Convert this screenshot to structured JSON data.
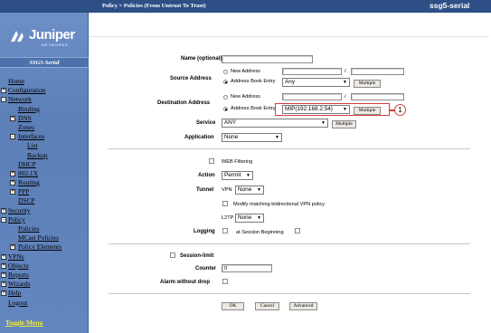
{
  "header": {
    "breadcrumb": "Policy > Policies (From Untrust To Trust)",
    "device_name": "ssg5-serial"
  },
  "sidebar": {
    "logo_text": "Juniper",
    "logo_subtext": "NETWORKS",
    "device_title": "SSG5-Serial",
    "items": [
      {
        "label": "Home",
        "level": 0,
        "expander": ""
      },
      {
        "label": "Configuration",
        "level": 0,
        "expander": "+"
      },
      {
        "label": "Network",
        "level": 0,
        "expander": "-"
      },
      {
        "label": "Binding",
        "level": 1,
        "expander": ""
      },
      {
        "label": "DNS",
        "level": 1,
        "expander": "+"
      },
      {
        "label": "Zones",
        "level": 1,
        "expander": ""
      },
      {
        "label": "Interfaces",
        "level": 1,
        "expander": "-"
      },
      {
        "label": "List",
        "level": 2,
        "expander": ""
      },
      {
        "label": "Backup",
        "level": 2,
        "expander": ""
      },
      {
        "label": "DHCP",
        "level": 1,
        "expander": ""
      },
      {
        "label": "802.1X",
        "level": 1,
        "expander": "+"
      },
      {
        "label": "Routing",
        "level": 1,
        "expander": "+"
      },
      {
        "label": "PPP",
        "level": 1,
        "expander": "+"
      },
      {
        "label": "DSCP",
        "level": 1,
        "expander": ""
      },
      {
        "label": "Security",
        "level": 0,
        "expander": "+"
      },
      {
        "label": "Policy",
        "level": 0,
        "expander": "-"
      },
      {
        "label": "Policies",
        "level": 1,
        "expander": ""
      },
      {
        "label": "MCast Policies",
        "level": 1,
        "expander": ""
      },
      {
        "label": "Policy Elements",
        "level": 1,
        "expander": "+"
      },
      {
        "label": "VPNs",
        "level": 0,
        "expander": "+"
      },
      {
        "label": "Objects",
        "level": 0,
        "expander": "+"
      },
      {
        "label": "Reports",
        "level": 0,
        "expander": "+"
      },
      {
        "label": "Wizards",
        "level": 0,
        "expander": "+"
      },
      {
        "label": "Help",
        "level": 0,
        "expander": "+"
      },
      {
        "label": "Logout",
        "level": 0,
        "expander": ""
      }
    ],
    "toggle_menu": "Toggle Menu"
  },
  "form": {
    "name_label": "Name (optional)",
    "name_value": "",
    "source_label": "Source Address",
    "new_address": "New Address",
    "slash": "/",
    "address_book_entry": "Address Book Entry",
    "source_value": "Any",
    "multiple": "Multiple",
    "dest_label": "Destination Address",
    "dest_value": "MIP(192.168.2.54)",
    "service_label": "Service",
    "service_value": "ANY",
    "application_label": "Application",
    "application_value": "None",
    "web_filtering": "WEB Filtering",
    "action_label": "Action",
    "action_value": "Permit",
    "tunnel_label": "Tunnel",
    "vpn_label": "VPN",
    "vpn_value": "None",
    "modify_vpn_policy": "Modify matching bidirectional VPN policy",
    "l2tp_label": "L2TP",
    "l2tp_value": "None",
    "logging_label": "Logging",
    "at_session_beginning": "at Session Beginning",
    "session_limit": "Session-limit",
    "counter_label": "Counter",
    "counter_value": "0",
    "alarm_label": "Alarm without drop",
    "ok": "OK",
    "cancel": "Cancel",
    "advanced": "Advanced"
  },
  "annotation": {
    "callout_number": "1"
  },
  "colors": {
    "header_bg": "#2d4f86",
    "sidebar_bg": "#6486bf",
    "toggle_text": "#f2ec3a",
    "callout": "#d53f3f"
  }
}
